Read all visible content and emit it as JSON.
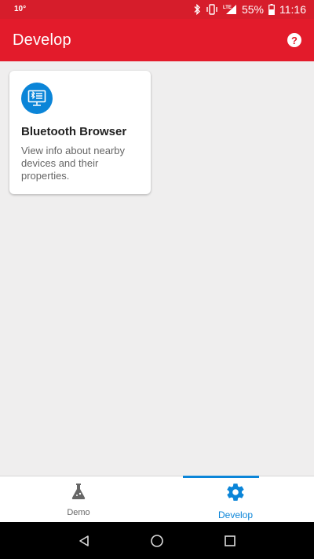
{
  "status_bar": {
    "left_text": "10°",
    "battery_percent": "55%",
    "time": "11:16",
    "network_label": "LTE"
  },
  "app_bar": {
    "title": "Develop",
    "help_label": "?"
  },
  "cards": [
    {
      "icon": "bluetooth-browser-icon",
      "title": "Bluetooth Browser",
      "description": "View info about nearby devices and their properties."
    }
  ],
  "bottom_nav": {
    "items": [
      {
        "label": "Demo",
        "icon": "flask-icon",
        "active": false
      },
      {
        "label": "Develop",
        "icon": "gear-icon",
        "active": true
      }
    ]
  },
  "colors": {
    "brand_red": "#e31b2b",
    "accent_blue": "#0b85d8",
    "background": "#efeeee"
  }
}
